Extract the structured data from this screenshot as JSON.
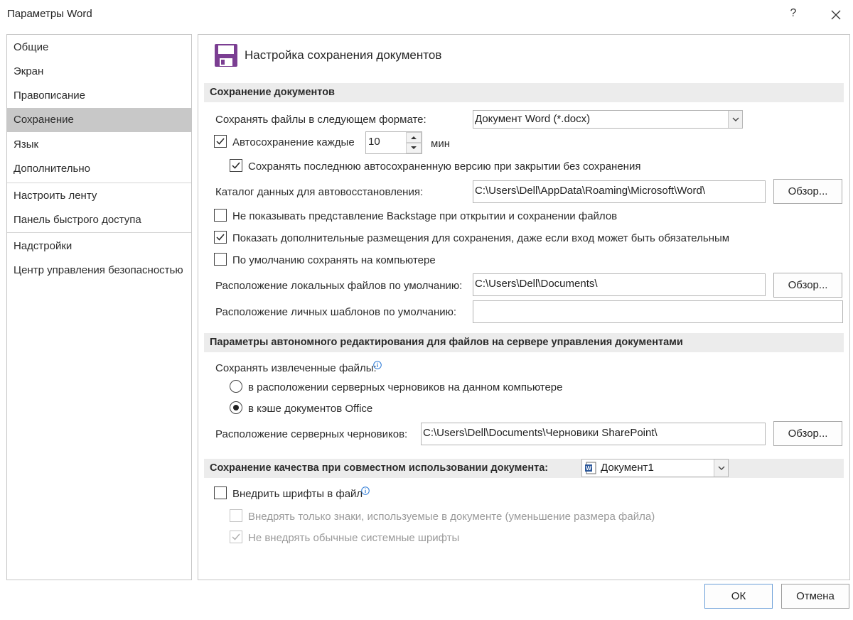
{
  "window": {
    "title": "Параметры Word",
    "help_glyph": "?",
    "close_glyph": "✕"
  },
  "sidebar": {
    "items": [
      {
        "label": "Общие"
      },
      {
        "label": "Экран"
      },
      {
        "label": "Правописание"
      },
      {
        "label": "Сохранение"
      },
      {
        "label": "Язык"
      },
      {
        "label": "Дополнительно"
      },
      {
        "label": "Настроить ленту"
      },
      {
        "label": "Панель быстрого доступа"
      },
      {
        "label": "Надстройки"
      },
      {
        "label": "Центр управления безопасностью"
      }
    ],
    "active_index": 3
  },
  "page": {
    "title": "Настройка сохранения документов",
    "icon": "save-floppy-icon",
    "accent_color": "#7b3e92"
  },
  "save_section": {
    "header": "Сохранение документов",
    "format_label": "Сохранять файлы в следующем формате:",
    "format_value": "Документ Word (*.docx)",
    "autosave_label": "Автосохранение каждые",
    "autosave_checked": true,
    "autosave_minutes": "10",
    "autosave_unit": "мин",
    "keep_last_label": "Сохранять последнюю автосохраненную версию при закрытии без сохранения",
    "keep_last_checked": true,
    "autorecover_label": "Каталог данных для автовосстановления:",
    "autorecover_path": "C:\\Users\\Dell\\AppData\\Roaming\\Microsoft\\Word\\",
    "browse_label": "Обзор...",
    "no_backstage_label": "Не показывать представление Backstage при открытии и сохранении файлов",
    "no_backstage_checked": false,
    "show_more_locations_label": "Показать дополнительные размещения для сохранения, даже если вход может быть обязательным",
    "show_more_locations_checked": true,
    "default_computer_label": "По умолчанию сохранять на компьютере",
    "default_computer_checked": false,
    "local_files_label": "Расположение локальных файлов по умолчанию:",
    "local_files_path": "C:\\Users\\Dell\\Documents\\",
    "templates_label": "Расположение личных шаблонов по умолчанию:",
    "templates_path": ""
  },
  "offline_section": {
    "header": "Параметры автономного редактирования для файлов на сервере управления документами",
    "save_checked_out_label": "Сохранять извлеченные файлы:",
    "option_server_drafts": "в расположении серверных черновиков на данном компьютере",
    "option_office_cache": "в кэше документов Office",
    "selected_option": "option_office_cache",
    "server_drafts_label": "Расположение серверных черновиков:",
    "server_drafts_path": "C:\\Users\\Dell\\Documents\\Черновики SharePoint\\"
  },
  "fidelity_section": {
    "header": "Сохранение качества при совместном использовании документа:",
    "document_value": "Документ1",
    "embed_fonts_label": "Внедрить шрифты в файл",
    "embed_fonts_checked": false,
    "embed_only_used_label": "Внедрять только знаки, используемые в документе (уменьшение размера файла)",
    "embed_only_used_checked": false,
    "no_common_fonts_label": "Не внедрять обычные системные шрифты",
    "no_common_fonts_checked": true
  },
  "footer": {
    "ok_label": "ОК",
    "cancel_label": "Отмена"
  }
}
